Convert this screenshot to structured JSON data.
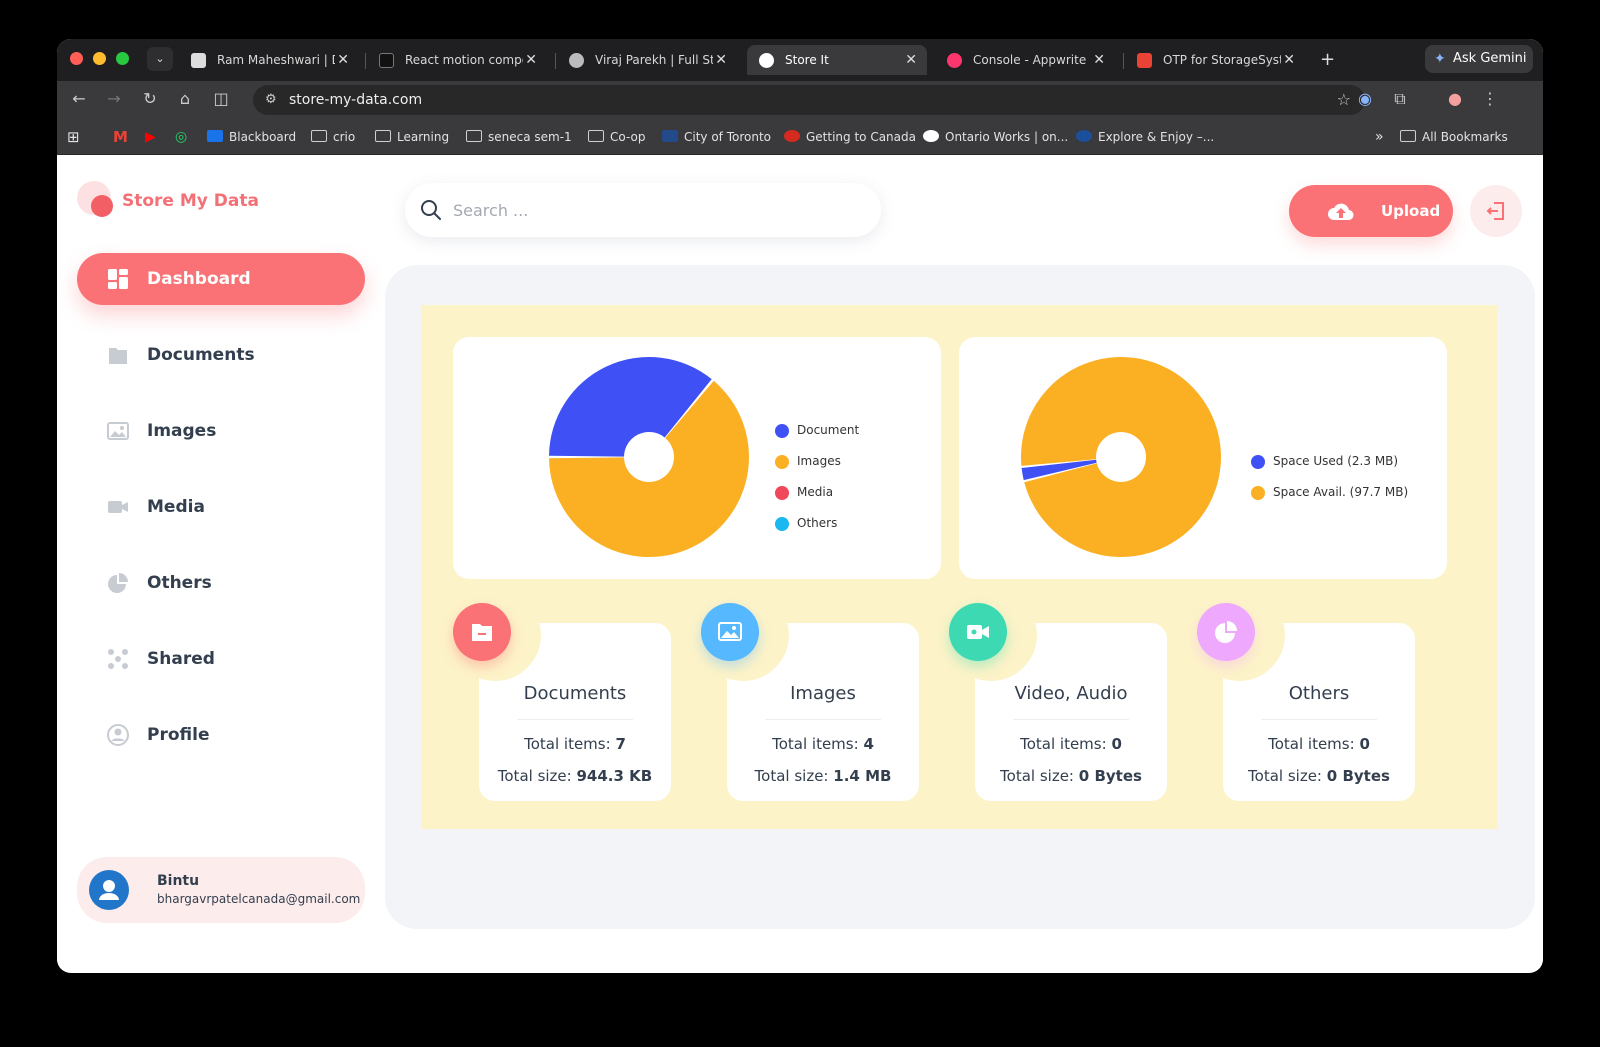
{
  "browser": {
    "tabs": [
      {
        "title": "Ram Maheshwari | De",
        "favicon_color": "#dddddd"
      },
      {
        "title": "React motion compo",
        "favicon_color": "#111111"
      },
      {
        "title": "Viraj Parekh | Full Sta",
        "favicon_color": "#bbbbbb"
      },
      {
        "title": "Store It",
        "favicon_color": "#ffffff"
      },
      {
        "title": "Console - Appwrite",
        "favicon_color": "#fd366e"
      },
      {
        "title": "OTP for StorageSyst",
        "favicon_color": "#ea4335"
      }
    ],
    "gemini_label": "Ask Gemini",
    "url": "store-my-data.com",
    "bookmarks": [
      "Blackboard",
      "crio",
      "Learning",
      "seneca sem-1",
      "Co-op",
      "City of Toronto",
      "Getting to Canada",
      "Ontario Works | on...",
      "Explore & Enjoy –..."
    ],
    "all_bookmarks": "All Bookmarks",
    "more_bookmarks": "»"
  },
  "app": {
    "brand": "Store My Data",
    "accent_color": "#fa7275",
    "search_placeholder": "Search ...",
    "upload_label": "Upload",
    "nav": [
      {
        "label": "Dashboard",
        "icon": "dashboard-icon",
        "active": true
      },
      {
        "label": "Documents",
        "icon": "documents-icon"
      },
      {
        "label": "Images",
        "icon": "images-icon"
      },
      {
        "label": "Media",
        "icon": "media-icon"
      },
      {
        "label": "Others",
        "icon": "others-icon"
      },
      {
        "label": "Shared",
        "icon": "shared-icon"
      },
      {
        "label": "Profile",
        "icon": "profile-icon"
      }
    ],
    "user": {
      "name": "Bintu",
      "email": "bhargavrpatelcanada@gmail.com"
    }
  },
  "chart_data": [
    {
      "type": "pie",
      "style": "donut",
      "categories": [
        "Document",
        "Images",
        "Media",
        "Others"
      ],
      "values": [
        36,
        64,
        0,
        0
      ],
      "colors": [
        "#3f51f5",
        "#fbb024",
        "#f0475a",
        "#1ab8f0"
      ],
      "legend": "right"
    },
    {
      "type": "pie",
      "style": "donut",
      "categories": [
        "Space Used (2.3 MB)",
        "Space Avail. (97.7 MB)"
      ],
      "values": [
        2.3,
        97.7
      ],
      "colors": [
        "#3f51f5",
        "#fbb024"
      ],
      "legend": "right"
    }
  ],
  "stats": [
    {
      "title": "Documents",
      "items_label": "Total items:",
      "items": "7",
      "size_label": "Total size:",
      "size": "944.3 KB",
      "icon": "documents-icon",
      "color": "#fa7275"
    },
    {
      "title": "Images",
      "items_label": "Total items:",
      "items": "4",
      "size_label": "Total size:",
      "size": "1.4 MB",
      "icon": "images-icon",
      "color": "#56b8ff"
    },
    {
      "title": "Video, Audio",
      "items_label": "Total items:",
      "items": "0",
      "size_label": "Total size:",
      "size": "0 Bytes",
      "icon": "video-icon",
      "color": "#3dd9b3"
    },
    {
      "title": "Others",
      "items_label": "Total items:",
      "items": "0",
      "size_label": "Total size:",
      "size": "0 Bytes",
      "icon": "others-icon",
      "color": "#eea8fd"
    }
  ]
}
